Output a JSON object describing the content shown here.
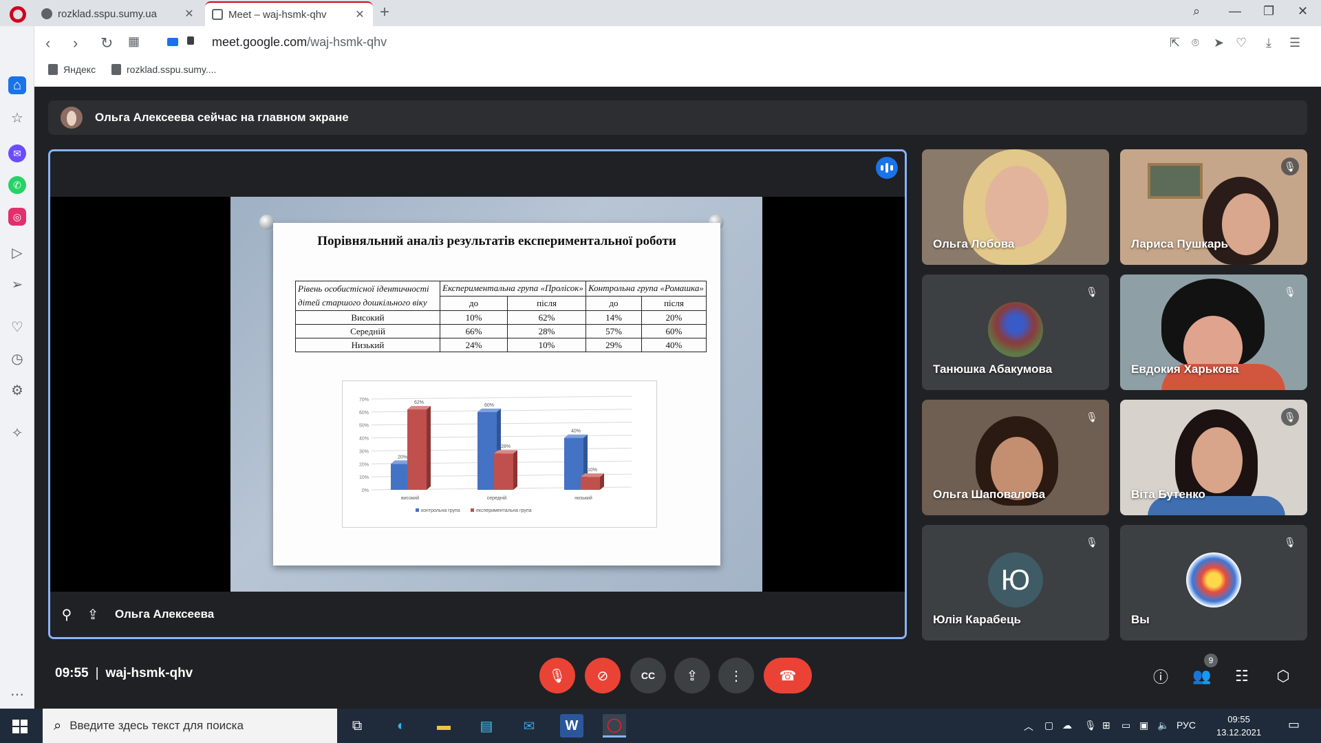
{
  "browser": {
    "tabs": [
      {
        "title": "rozklad.sspu.sumy.ua",
        "active": false
      },
      {
        "title": "Meet – waj-hsmk-qhv",
        "active": true
      }
    ],
    "url_domain": "meet.google.com",
    "url_path": "/waj-hsmk-qhv",
    "bookmarks": [
      {
        "label": "Яндекс"
      },
      {
        "label": "rozklad.sspu.sumy...."
      }
    ]
  },
  "meet": {
    "presenting_banner": "Ольга Алексеева сейчас на главном экране",
    "presenter_name": "Ольга Алексеева",
    "time": "09:55",
    "meeting_code": "waj-hsmk-qhv",
    "participants_count": "9",
    "participants": [
      {
        "name": "Ольга Лобова",
        "muted": false
      },
      {
        "name": "Лариса Пушкарь",
        "muted": true
      },
      {
        "name": "Танюшка Абакумова",
        "muted": true
      },
      {
        "name": "Евдокия Харькова",
        "muted": true
      },
      {
        "name": "Ольга Шаповалова",
        "muted": true
      },
      {
        "name": "Віта Бутенко",
        "muted": true
      },
      {
        "name": "Юлія Карабець",
        "muted": true,
        "initial": "Ю"
      },
      {
        "name": "Вы",
        "muted": true
      }
    ]
  },
  "slide": {
    "title": "Порівняльний аналіз результатів експериментальної роботи",
    "table": {
      "col0": "Рівень особистісної ідентичності дітей старшого дошкільного віку",
      "group1": "Експериментальна група «Пролісок»",
      "group2": "Контрольна група «Ромашка»",
      "sub": [
        "до",
        "після",
        "до",
        "після"
      ],
      "rows": [
        {
          "level": "Високий",
          "values": [
            "10%",
            "62%",
            "14%",
            "20%"
          ]
        },
        {
          "level": "Середній",
          "values": [
            "66%",
            "28%",
            "57%",
            "60%"
          ]
        },
        {
          "level": "Низький",
          "values": [
            "24%",
            "10%",
            "29%",
            "40%"
          ]
        }
      ]
    }
  },
  "chart_data": {
    "type": "bar",
    "categories": [
      "високий",
      "середній",
      "низький"
    ],
    "series": [
      {
        "name": "контрольна група",
        "values": [
          20,
          60,
          40
        ],
        "color": "#4472c4"
      },
      {
        "name": "експериментальна група",
        "values": [
          62,
          28,
          10
        ],
        "color": "#c0504d"
      }
    ],
    "data_labels": [
      "20%",
      "62%",
      "60%",
      "28%",
      "40%",
      "10%"
    ],
    "y_ticks": [
      "0%",
      "10%",
      "20%",
      "30%",
      "40%",
      "50%",
      "60%",
      "70%"
    ],
    "ylim": [
      0,
      70
    ],
    "legend_position": "bottom"
  },
  "taskbar": {
    "search_placeholder": "Введите здесь текст для поиска",
    "lang": "РУС",
    "time": "09:55",
    "date": "13.12.2021"
  }
}
